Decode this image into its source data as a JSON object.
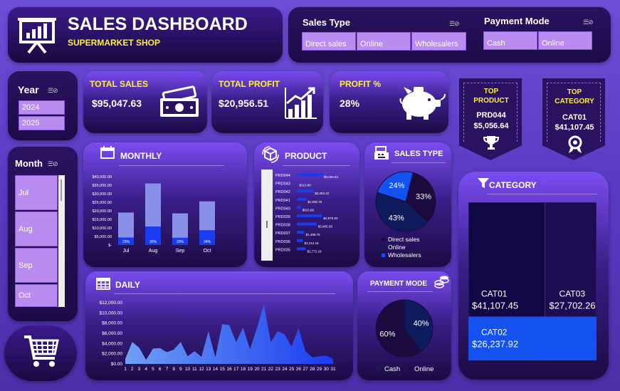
{
  "header": {
    "title": "SALES DASHBOARD",
    "subtitle": "SUPERMARKET SHOP"
  },
  "sales_type_slicer": {
    "title": "Sales Type",
    "options": [
      "Direct sales",
      "Online",
      "Wholesalers"
    ]
  },
  "payment_slicer": {
    "title": "Payment Mode",
    "options": [
      "Cash",
      "Online"
    ]
  },
  "year_slicer": {
    "title": "Year",
    "options": [
      "2024",
      "2025"
    ]
  },
  "month_slicer": {
    "title": "Month",
    "options": [
      "Jul",
      "Aug",
      "Sep",
      "Oct"
    ]
  },
  "kpis": {
    "total_sales": {
      "label": "TOTAL SALES",
      "value": "$95,047.63"
    },
    "total_profit": {
      "label": "TOTAL PROFIT",
      "value": "$20,956.51"
    },
    "profit_pct": {
      "label": "PROFIT %",
      "value": "28%"
    }
  },
  "top_product": {
    "label": "TOP PRODUCT",
    "name": "PRD044",
    "value": "$5,056.64"
  },
  "top_category": {
    "label": "TOP CATEGORY",
    "name": "CAT01",
    "value": "$41,107.45"
  },
  "colors": {
    "accent_yellow": "#ffef3a",
    "bar_light": "#8a8fe8",
    "bar_blue": "#1a3cf0",
    "pie_blue": "#1452f0",
    "pie_navy": "#0d1a5c",
    "pie_dark": "#1a0a3e"
  },
  "chart_data": [
    {
      "id": "monthly",
      "title": "MONTHLY",
      "type": "bar",
      "categories": [
        "Jul",
        "Aug",
        "Sep",
        "Oct"
      ],
      "series": [
        {
          "name": "Sales",
          "values": [
            19000,
            36000,
            18500,
            25500
          ]
        },
        {
          "name": "Profit",
          "values": [
            4370,
            10800,
            4255,
            8670
          ]
        }
      ],
      "data_labels": [
        "23%",
        "30%",
        "23%",
        "34%"
      ],
      "yticks": [
        "$40,000.00",
        "$35,000.00",
        "$30,000.00",
        "$25,000.00",
        "$20,000.00",
        "$15,000.00",
        "$10,000.00",
        "$5,000.00",
        "$-"
      ],
      "ylim": [
        0,
        40000
      ]
    },
    {
      "id": "product",
      "title": "PRODUCT",
      "type": "bar",
      "categories": [
        "PRD044",
        "PRD043",
        "PRD042",
        "PRD041",
        "PRD040",
        "PRD039",
        "PRD038",
        "PRD037",
        "PRD036",
        "PRD035"
      ],
      "values": [
        5056.64,
        213.8,
        3263.22,
        1835.76,
        815.86,
        4976.93,
        3905.58,
        1498.75,
        1212.16,
        1772.16
      ],
      "data_labels": [
        "$5,056.64",
        "$213.80",
        "$3,263.22",
        "$1,835.76",
        "$815.86",
        "$4,976.93",
        "$3,905.58",
        "$1,498.75",
        "$1,212.16",
        "$1,772.16"
      ]
    },
    {
      "id": "sales_type",
      "title": "SALES TYPE",
      "type": "pie",
      "categories": [
        "Direct sales",
        "Online",
        "Wholesalers"
      ],
      "values": [
        33,
        43,
        24
      ],
      "data_labels": [
        "33%",
        "43%",
        "24%"
      ]
    },
    {
      "id": "payment_mode",
      "title": "PAYMENT MODE",
      "type": "pie",
      "categories": [
        "Cash",
        "Online"
      ],
      "values": [
        40,
        60
      ],
      "data_labels": [
        "40%",
        "60%"
      ]
    },
    {
      "id": "category",
      "title": "CATEGORY",
      "type": "heatmap",
      "categories": [
        "CAT01",
        "CAT03",
        "CAT02"
      ],
      "values": [
        41107.45,
        27702.26,
        26237.92
      ],
      "data_labels": [
        "$41,107.45",
        "$27,702.26",
        "$26,237.92"
      ]
    },
    {
      "id": "daily",
      "title": "DAILY",
      "type": "area",
      "x": [
        "1",
        "2",
        "3",
        "4",
        "5",
        "6",
        "7",
        "8",
        "9",
        "10",
        "11",
        "12",
        "13",
        "14",
        "15",
        "16",
        "17",
        "18",
        "19",
        "20",
        "21",
        "22",
        "23",
        "24",
        "25",
        "26",
        "27",
        "28",
        "29",
        "30",
        "31"
      ],
      "values": [
        1000,
        4300,
        3200,
        800,
        3000,
        3100,
        2300,
        2800,
        4300,
        1500,
        2500,
        1400,
        6400,
        1300,
        7800,
        7600,
        4300,
        7100,
        2900,
        7000,
        11700,
        4300,
        6400,
        5800,
        3400,
        7000,
        2500,
        1300,
        1500,
        1600,
        1000
      ],
      "yticks": [
        "$12,000.00",
        "$10,000.00",
        "$8,000.00",
        "$6,000.00",
        "$4,000.00",
        "$2,000.00",
        "$0.00"
      ],
      "ylim": [
        0,
        12000
      ]
    }
  ]
}
